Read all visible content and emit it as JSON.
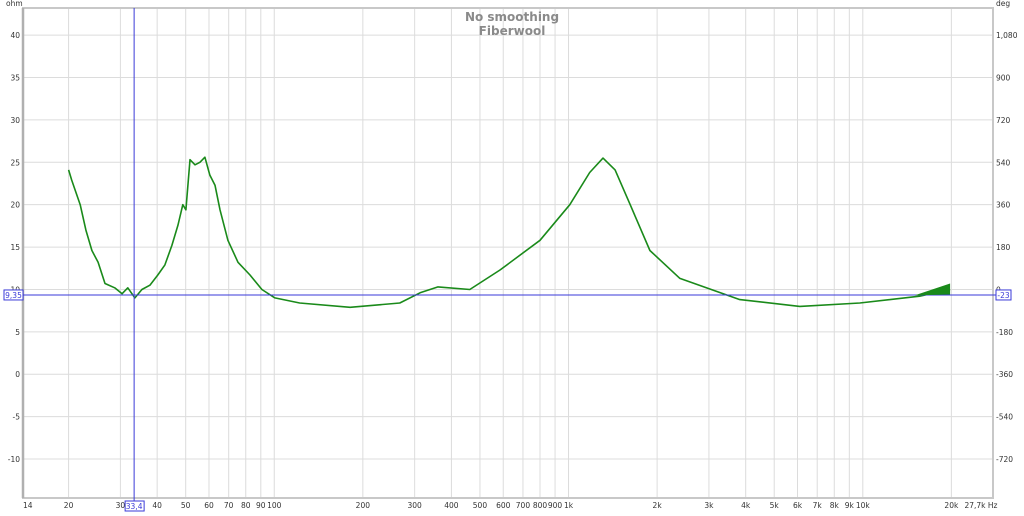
{
  "chart_data": {
    "type": "line",
    "title": "No smoothing",
    "subtitle": "Fiberwool",
    "xlabel": "Hz",
    "ylabel": "ohm",
    "y2label": "deg",
    "xscale": "log",
    "xlim": [
      14,
      27700
    ],
    "ylim": [
      -14.6,
      43.2
    ],
    "grid": true,
    "x_ticks": [
      {
        "v": 14,
        "label": "14"
      },
      {
        "v": 20,
        "label": "20"
      },
      {
        "v": 30,
        "label": "30"
      },
      {
        "v": 40,
        "label": "40"
      },
      {
        "v": 50,
        "label": "50"
      },
      {
        "v": 60,
        "label": "60"
      },
      {
        "v": 70,
        "label": "70"
      },
      {
        "v": 80,
        "label": "80"
      },
      {
        "v": 90,
        "label": "90"
      },
      {
        "v": 100,
        "label": "100"
      },
      {
        "v": 200,
        "label": "200"
      },
      {
        "v": 300,
        "label": "300"
      },
      {
        "v": 400,
        "label": "400"
      },
      {
        "v": 500,
        "label": "500"
      },
      {
        "v": 600,
        "label": "600"
      },
      {
        "v": 700,
        "label": "700"
      },
      {
        "v": 800,
        "label": "800"
      },
      {
        "v": 900,
        "label": "900"
      },
      {
        "v": 1000,
        "label": "1k"
      },
      {
        "v": 2000,
        "label": "2k"
      },
      {
        "v": 3000,
        "label": "3k"
      },
      {
        "v": 4000,
        "label": "4k"
      },
      {
        "v": 5000,
        "label": "5k"
      },
      {
        "v": 6000,
        "label": "6k"
      },
      {
        "v": 7000,
        "label": "7k"
      },
      {
        "v": 8000,
        "label": "8k"
      },
      {
        "v": 9000,
        "label": "9k"
      },
      {
        "v": 10000,
        "label": "10k"
      },
      {
        "v": 20000,
        "label": "20k"
      },
      {
        "v": 27700,
        "label": "27,7k Hz"
      }
    ],
    "y_ticks": [
      40,
      35,
      30,
      25,
      20,
      15,
      10,
      5,
      0,
      -5,
      -10
    ],
    "y2_ticks": [
      {
        "ohm": 40,
        "label": "1,080"
      },
      {
        "ohm": 35,
        "label": "900"
      },
      {
        "ohm": 30,
        "label": "720"
      },
      {
        "ohm": 25,
        "label": "540"
      },
      {
        "ohm": 20,
        "label": "360"
      },
      {
        "ohm": 15,
        "label": "180"
      },
      {
        "ohm": 10,
        "label": "0"
      },
      {
        "ohm": 5,
        "label": "-180"
      },
      {
        "ohm": 0,
        "label": "-360"
      },
      {
        "ohm": -5,
        "label": "-540"
      },
      {
        "ohm": -10,
        "label": "-720"
      }
    ],
    "series": [
      {
        "name": "Fiberwool",
        "color": "#1a8a1a",
        "x": [
          20,
          20.5,
          21.9,
          22.9,
          24.0,
          25.2,
          26.6,
          28.7,
          30.4,
          31.8,
          33.6,
          35.5,
          37.8,
          40.2,
          42.5,
          44.9,
          47.1,
          48.9,
          50.1,
          51.7,
          53.8,
          55.9,
          58.1,
          60.4,
          62.9,
          65.4,
          69.6,
          75.3,
          82.7,
          90.8,
          100.5,
          122,
          181,
          267,
          313,
          360,
          462,
          585,
          800,
          1010,
          1180,
          1310,
          1440,
          1620,
          1890,
          2390,
          3820,
          6110,
          9770,
          15600,
          19800
        ],
        "y": [
          24.1,
          22.9,
          20,
          17,
          14.6,
          13.2,
          10.7,
          10.2,
          9.5,
          10.2,
          9.0,
          10,
          10.5,
          11.7,
          12.9,
          15.2,
          17.6,
          20,
          19.4,
          25.3,
          24.7,
          25,
          25.6,
          23.5,
          22.3,
          19.4,
          15.8,
          13.2,
          11.7,
          10,
          9,
          8.4,
          7.9,
          8.4,
          9.6,
          10.3,
          10,
          12.3,
          15.8,
          20,
          23.8,
          25.5,
          24.1,
          20,
          14.6,
          11.3,
          8.8,
          8.0,
          8.4,
          9.2,
          10
        ]
      }
    ],
    "cursor": {
      "x": 33.4,
      "x_label": "33,4",
      "y": 9.35,
      "y_label": "9,35",
      "y2_label": "-23",
      "color": "#3a3ad8"
    }
  }
}
